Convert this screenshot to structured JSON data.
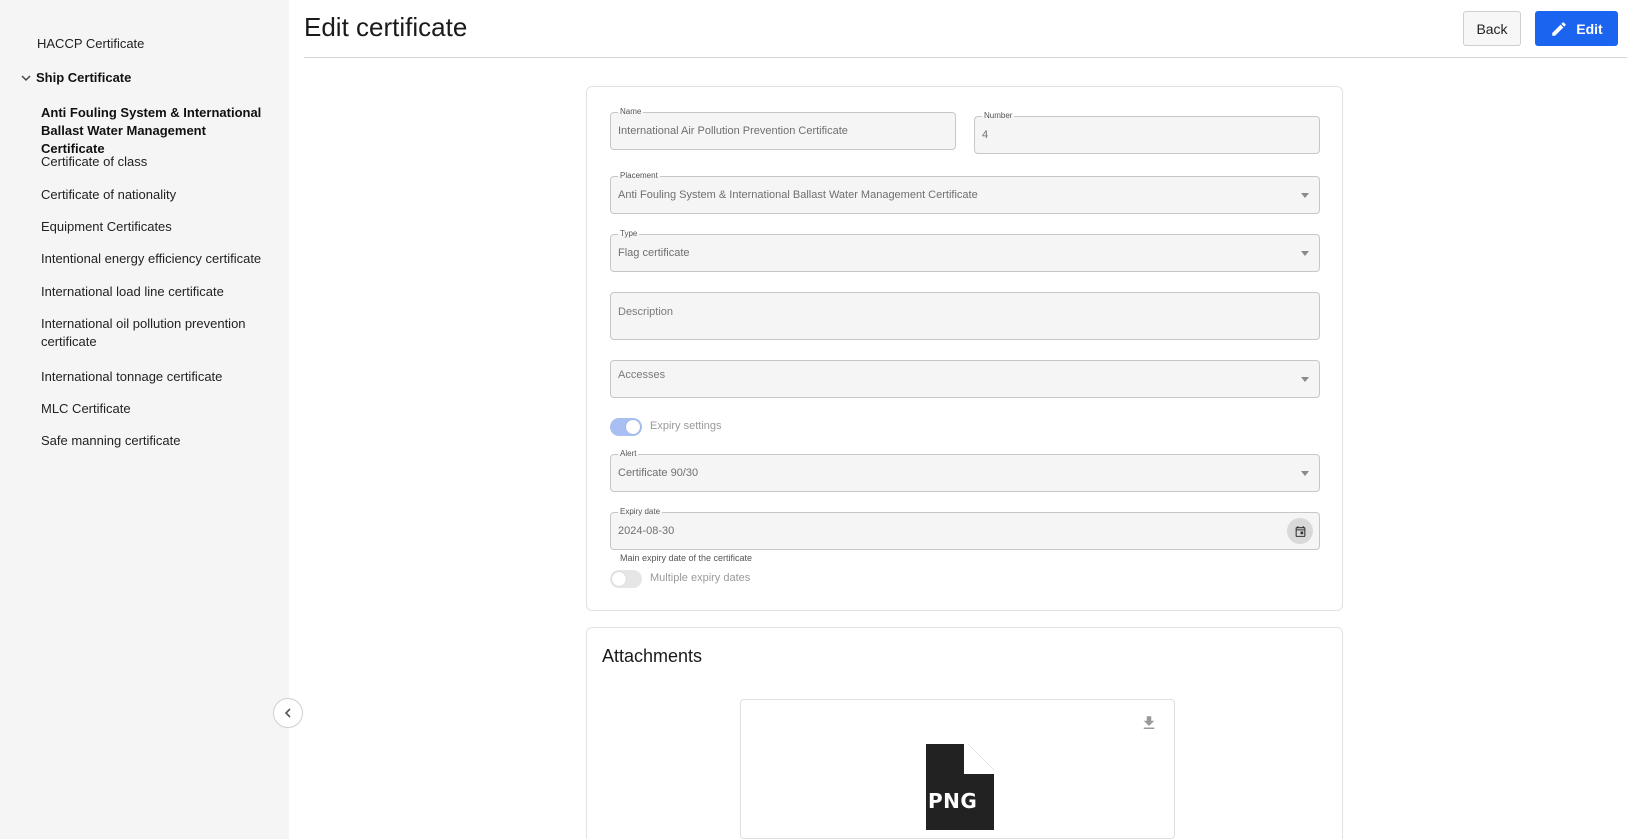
{
  "sidebar": {
    "top_item": "HACCP Certificate",
    "group_label": "Ship Certificate",
    "items": [
      {
        "label": "Anti Fouling System & International Ballast Water Management Certificate",
        "active": true
      },
      {
        "label": "Certificate of class"
      },
      {
        "label": "Certificate of nationality"
      },
      {
        "label": "Equipment Certificates"
      },
      {
        "label": "Intentional energy efficiency certificate"
      },
      {
        "label": "International load line certificate"
      },
      {
        "label": "International oil pollution prevention certificate"
      },
      {
        "label": "International tonnage certificate"
      },
      {
        "label": "MLC Certificate"
      },
      {
        "label": "Safe manning certificate"
      }
    ]
  },
  "header": {
    "title": "Edit certificate",
    "back_label": "Back",
    "edit_label": "Edit"
  },
  "form": {
    "name_label": "Name",
    "name_value": "International Air Pollution Prevention Certificate",
    "number_label": "Number",
    "number_value": "4",
    "placement_label": "Placement",
    "placement_value": "Anti Fouling System & International Ballast Water Management Certificate",
    "type_label": "Type",
    "type_value": "Flag certificate",
    "description_placeholder": "Description",
    "accesses_placeholder": "Accesses",
    "expiry_settings_label": "Expiry settings",
    "expiry_settings_on": true,
    "alert_label": "Alert",
    "alert_value": "Certificate 90/30",
    "expiry_date_label": "Expiry date",
    "expiry_date_value": "2024-08-30",
    "expiry_helper": "Main expiry date of the certificate",
    "multiple_expiry_label": "Multiple expiry dates",
    "multiple_expiry_on": false
  },
  "attachments": {
    "title": "Attachments",
    "file_type_label": "PNG"
  },
  "colors": {
    "accent": "#1a64f0",
    "toggle_on": "#a9bff3",
    "toggle_off": "#e6e6e6"
  }
}
